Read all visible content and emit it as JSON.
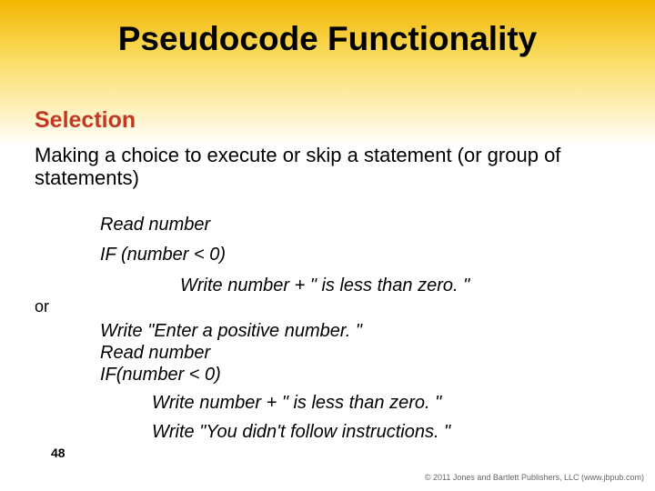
{
  "title": "Pseudocode Functionality",
  "subtitle": "Selection",
  "intro": "Making a choice to execute or skip a statement (or group of statements)",
  "code1": {
    "l1": "Read number",
    "l2": "IF (number < 0)",
    "l3": "Write number + \" is less than zero. \""
  },
  "or_label": "or",
  "code2": {
    "l1": "Write \"Enter a positive number. \"",
    "l2": "Read number",
    "l3": "IF(number < 0)",
    "l4": "Write number + \" is less than zero. \"",
    "l5": "Write \"You didn't follow instructions. \""
  },
  "pagenum": "48",
  "copyright": "© 2011 Jones and Bartlett Publishers, LLC (www.jbpub.com)"
}
